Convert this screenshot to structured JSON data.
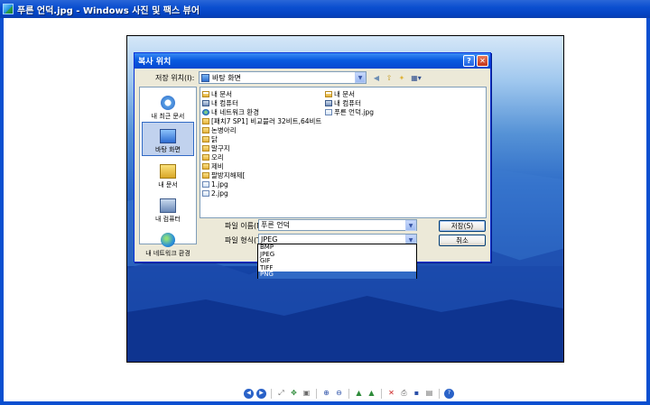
{
  "window": {
    "title": "푸른 언덕.jpg - Windows 사진 및 팩스 뷰어"
  },
  "dialog": {
    "title": "복사 위치",
    "help_label": "?",
    "close_label": "✕",
    "look_in_label": "저장 위치(I):",
    "look_in_value": "바탕 화면",
    "places": [
      {
        "label": "내 최근 문서",
        "icon": "recent-documents-icon"
      },
      {
        "label": "바탕 화면",
        "icon": "desktop-icon",
        "selected": true
      },
      {
        "label": "내 문서",
        "icon": "my-documents-icon"
      },
      {
        "label": "내 컴퓨터",
        "icon": "my-computer-icon"
      },
      {
        "label": "내 네트워크 환경",
        "icon": "network-icon"
      }
    ],
    "files": [
      {
        "name": "내 문서",
        "icon": "my-documents-icon"
      },
      {
        "name": "내 컴퓨터",
        "icon": "my-computer-icon"
      },
      {
        "name": "내 네트워크 환경",
        "icon": "network-icon"
      },
      {
        "name": "[패치7 SP1] 비교블러 32비트,64비트",
        "icon": "folder-icon"
      },
      {
        "name": "논병아리",
        "icon": "folder-icon"
      },
      {
        "name": "닭",
        "icon": "folder-icon"
      },
      {
        "name": "말구지",
        "icon": "folder-icon"
      },
      {
        "name": "오리",
        "icon": "folder-icon"
      },
      {
        "name": "제비",
        "icon": "folder-icon"
      },
      {
        "name": "팔방지해제[",
        "icon": "folder-icon"
      },
      {
        "name": "1.jpg",
        "icon": "image-file-icon"
      },
      {
        "name": "2.jpg",
        "icon": "image-file-icon"
      },
      {
        "name": "내 문서",
        "icon": "my-documents-icon"
      },
      {
        "name": "내 컴퓨터",
        "icon": "my-computer-icon"
      },
      {
        "name": "푸른 언덕.jpg",
        "icon": "image-file-icon"
      }
    ],
    "file_name_label": "파일 이름(N):",
    "file_name_value": "푸른 언덕",
    "file_type_label": "파일 형식(T):",
    "file_type_value": "JPEG",
    "file_type_options": [
      "BMP",
      "JPEG",
      "GIF",
      "TIFF",
      "PNG"
    ],
    "file_type_highlighted": "PNG",
    "save_label": "저장(S)",
    "cancel_label": "취소"
  },
  "viewer_toolbar": [
    "previous-image-icon",
    "next-image-icon",
    "best-fit-icon",
    "actual-size-icon",
    "slideshow-icon",
    "zoom-in-icon",
    "zoom-out-icon",
    "rotate-clockwise-icon",
    "rotate-counterclockwise-icon",
    "delete-icon",
    "print-icon",
    "copy-to-icon",
    "open-for-editing-icon",
    "help-icon"
  ]
}
